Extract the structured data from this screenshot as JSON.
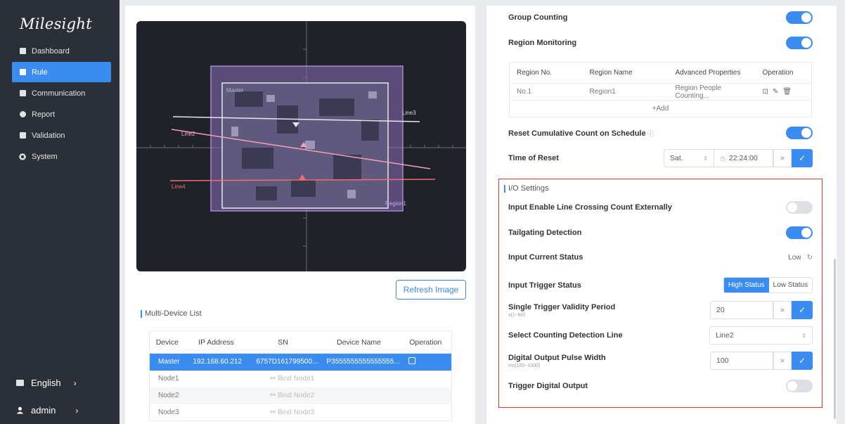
{
  "sidebar": {
    "logo": "Milesight",
    "items": [
      {
        "label": "Dashboard",
        "icon": "dashboard-icon"
      },
      {
        "label": "Rule",
        "icon": "rule-icon"
      },
      {
        "label": "Communication",
        "icon": "communication-icon"
      },
      {
        "label": "Report",
        "icon": "report-icon"
      },
      {
        "label": "Validation",
        "icon": "validation-icon"
      },
      {
        "label": "System",
        "icon": "gear-icon"
      }
    ],
    "language": "English",
    "user": "admin",
    "chevron": "›"
  },
  "canvas": {
    "master_label": "Master",
    "lines": [
      "Line3",
      "Line2",
      "Line4"
    ],
    "region_label": "Region1"
  },
  "left": {
    "refresh_label": "Refresh Image",
    "multi_device_title": "Multi-Device List",
    "table": {
      "headers": [
        "Device",
        "IP Address",
        "SN",
        "Device Name",
        "Operation"
      ],
      "master": {
        "device": "Master",
        "ip": "192.168.60.212",
        "sn": "6757D161799500...",
        "name": "P3555555555555555..."
      },
      "nodes": [
        {
          "device": "Node1",
          "bind": "Bind Node1"
        },
        {
          "device": "Node2",
          "bind": "Bind Node2"
        },
        {
          "device": "Node3",
          "bind": "Bind Node3"
        }
      ]
    }
  },
  "right": {
    "group_counting": "Group Counting",
    "region_monitoring": "Region Monitoring",
    "region_table": {
      "headers": [
        "Region No.",
        "Region Name",
        "Advanced Properties",
        "Operation"
      ],
      "rows": [
        {
          "no": "No.1",
          "name": "Region1",
          "props": "Region People Counting..."
        }
      ],
      "add_label": "+Add"
    },
    "reset_schedule": "Reset Cumulative Count on Schedule",
    "time_of_reset": "Time of Reset",
    "reset_day": "Sat.",
    "reset_time": "22:24:00",
    "io_title": "I/O Settings",
    "input_enable": "Input Enable Line Crossing Count Externally",
    "tailgating": "Tailgating Detection",
    "input_current": "Input Current Status",
    "input_current_value": "Low",
    "input_trigger": "Input Trigger Status",
    "high_status": "High Status",
    "low_status": "Low Status",
    "single_trigger": "Single Trigger Validity Period",
    "single_trigger_hint": "s(1~60)",
    "single_trigger_value": "20",
    "select_line": "Select Counting Detection Line",
    "select_line_value": "Line2",
    "pulse_width": "Digital Output Pulse Width",
    "pulse_width_hint": "ms(100~1000)",
    "pulse_width_value": "100",
    "trigger_output": "Trigger Digital Output",
    "toggles": {
      "group_counting": true,
      "region_monitoring": true,
      "reset_schedule": true,
      "input_enable": false,
      "tailgating": true,
      "trigger_output": false
    }
  },
  "colors": {
    "accent": "#3b8cf0",
    "sidebar": "#2b2f37",
    "highlight": "#e0362c"
  }
}
